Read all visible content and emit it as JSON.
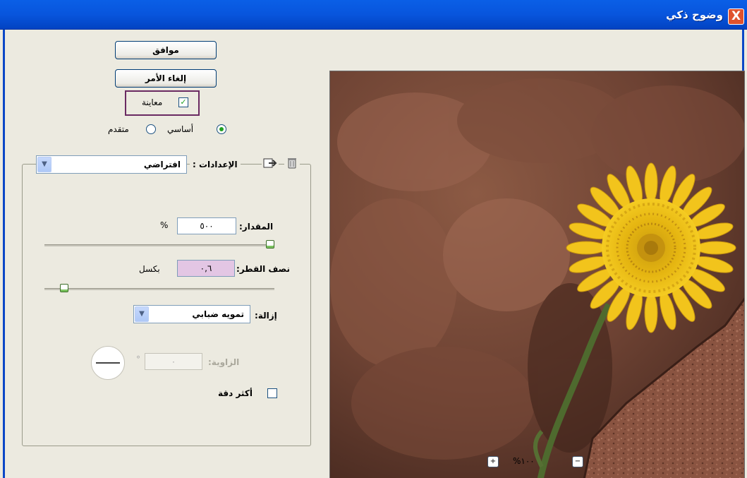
{
  "window": {
    "title": "وضوح ذكي",
    "close_label": "X"
  },
  "buttons": {
    "ok": "موافق",
    "cancel": "إلغاء الأمر"
  },
  "preview_option": {
    "label": "معاينة",
    "checked": true
  },
  "mode": {
    "basic": "أساسي",
    "advanced": "متقدم",
    "selected": "basic"
  },
  "settings": {
    "label": "الإعدادات :",
    "value": "افتراضي"
  },
  "amount": {
    "label": "المقدار:",
    "value": "٥٠٠",
    "unit": "%",
    "slider_fraction": 1.0
  },
  "radius": {
    "label": "نصف القطر:",
    "value": "٠,٦",
    "unit": "بكسل",
    "slider_fraction": 0.07
  },
  "remove": {
    "label": "إزالة:",
    "value": "تمويه ضبابي"
  },
  "angle": {
    "label": "الزاوية:",
    "value": "٠",
    "unit": "°"
  },
  "more_accurate": {
    "label": "أكثر دقة",
    "checked": false
  },
  "zoom": {
    "level": "١٠٠%",
    "zoom_in": "+",
    "zoom_out": "−"
  },
  "colors": {
    "titlebar": "#0855dd",
    "preview_checkbox_highlight": "#6a2a62",
    "radius_field_bg": "#e3c6e4",
    "flower": "#f0c21a",
    "rock": "#7a4b36"
  }
}
